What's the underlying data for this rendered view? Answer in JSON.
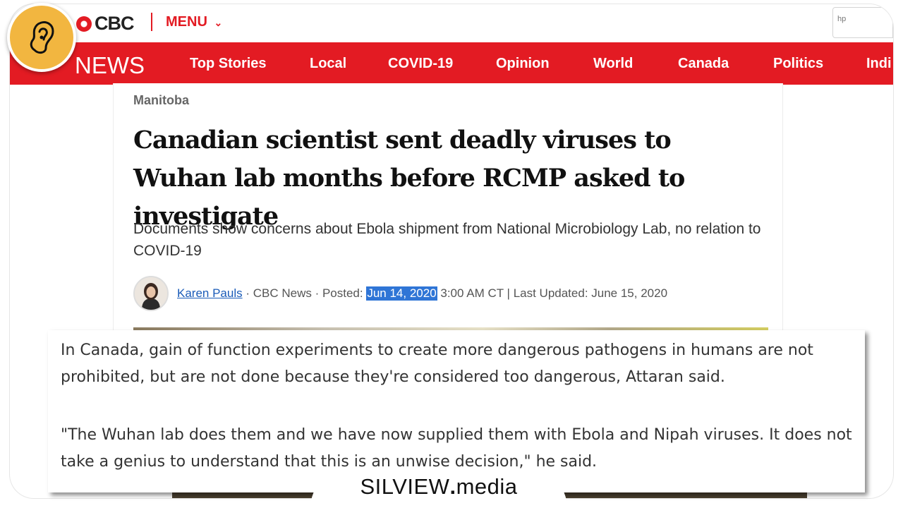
{
  "header": {
    "logo_text": "CBC",
    "menu_label": "MENU",
    "search_placeholder": "hp"
  },
  "nav": {
    "section": "NEWS",
    "items": [
      "Top Stories",
      "Local",
      "COVID-19",
      "Opinion",
      "World",
      "Canada",
      "Politics",
      "Indi"
    ]
  },
  "article": {
    "category": "Manitoba",
    "headline": "Canadian scientist sent deadly viruses to Wuhan lab months before RCMP asked to investigate",
    "dek": "Documents show concerns about Ebola shipment from National Microbiology Lab, no relation to COVID-19",
    "byline": {
      "author": "Karen Pauls",
      "outlet": " · CBC News · Posted: ",
      "posted_date": "Jun 14, 2020",
      "posted_time": " 3:00 AM CT | Last Updated: June 15, 2020"
    }
  },
  "quote": {
    "paragraph1": "In Canada, gain of function experiments to create more dangerous pathogens in humans are not prohibited, but are not done because they're considered too dangerous, Attaran said.",
    "paragraph2": "\"The Wuhan lab does them and we have now supplied them with Ebola and Nipah viruses. It does not take a genius to understand that this is an unwise decision,\" he said."
  },
  "watermark": {
    "name": "SILVIEW",
    "dot": ".",
    "suffix": "media"
  },
  "colors": {
    "brand_red": "#e31b23",
    "highlight_blue": "#2f75d6",
    "badge_gold": "#f2b640"
  }
}
